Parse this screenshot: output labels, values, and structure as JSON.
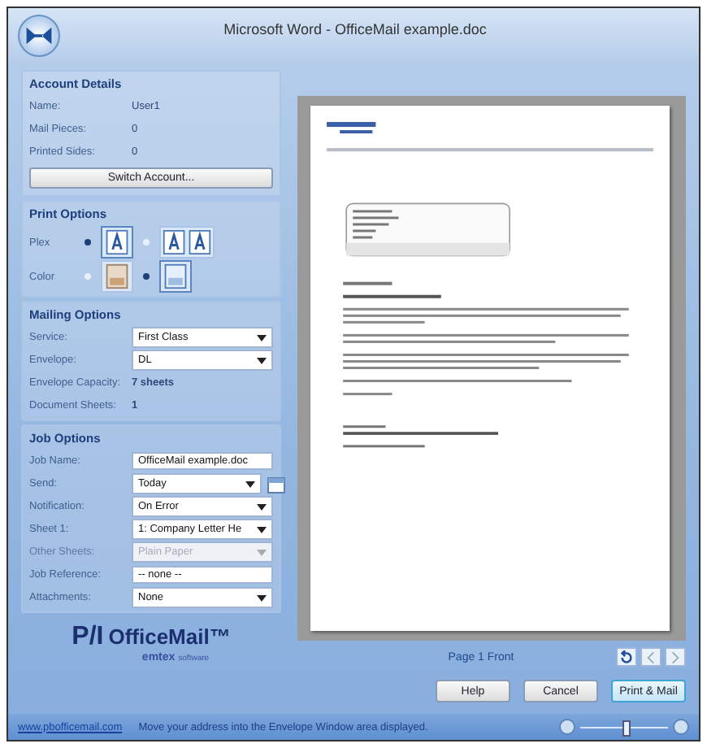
{
  "window": {
    "title": "Microsoft Word - OfficeMail example.doc"
  },
  "account_details": {
    "heading": "Account Details",
    "fields": [
      {
        "label": "Name:",
        "value": "User1"
      },
      {
        "label": "Mail Pieces:",
        "value": "0"
      },
      {
        "label": "Printed Sides:",
        "value": "0"
      }
    ],
    "button": "Switch Account..."
  },
  "print_options": {
    "heading": "Print Options",
    "options": [
      {
        "label": "Plex",
        "choices": [
          {
            "kind": "simplex",
            "selected": true
          },
          {
            "kind": "duplex",
            "selected": false
          }
        ]
      },
      {
        "label": "Color",
        "choices": [
          {
            "kind": "color",
            "selected": false
          },
          {
            "kind": "mono",
            "selected": true
          }
        ]
      }
    ]
  },
  "mailing_options": {
    "heading": "Mailing Options",
    "rows": [
      {
        "kind": "select",
        "label": "Service:",
        "value": "First Class"
      },
      {
        "kind": "select",
        "label": "Envelope:",
        "value": "DL"
      },
      {
        "kind": "info",
        "label": "Envelope Capacity:",
        "value": "7 sheets"
      },
      {
        "kind": "info",
        "label": "Document Sheets:",
        "value": "1"
      }
    ]
  },
  "job_options": {
    "heading": "Job Options",
    "rows": [
      {
        "kind": "input",
        "label": "Job Name:",
        "value": "OfficeMail example.doc",
        "disabled": false
      },
      {
        "kind": "select_button",
        "label": "Send:",
        "value": "Today",
        "disabled": false
      },
      {
        "kind": "select",
        "label": "Notification:",
        "value": "On Error",
        "disabled": false
      },
      {
        "kind": "select",
        "label": "Sheet 1:",
        "value": "1: Company Letter He",
        "disabled": false
      },
      {
        "kind": "select",
        "label": "Other Sheets:",
        "value": "Plain Paper",
        "disabled": true
      },
      {
        "kind": "input",
        "label": "Job Reference:",
        "value": "-- none --",
        "disabled": false
      },
      {
        "kind": "select",
        "label": "Attachments:",
        "value": "None",
        "disabled": false
      }
    ]
  },
  "logo": {
    "mark": "P/I",
    "product": "OfficeMail™",
    "vendor": "emtex",
    "vendor_suffix": "software"
  },
  "preview": {
    "page_label": "Page 1 Front"
  },
  "buttons": [
    {
      "label": "Help",
      "primary": false
    },
    {
      "label": "Cancel",
      "primary": false
    },
    {
      "label": "Print & Mail",
      "primary": true
    }
  ],
  "status_bar": {
    "link": "www.pbofficemail.com",
    "message": "Move your address into the Envelope Window area displayed.",
    "zoom": {
      "level": 0.5
    }
  }
}
